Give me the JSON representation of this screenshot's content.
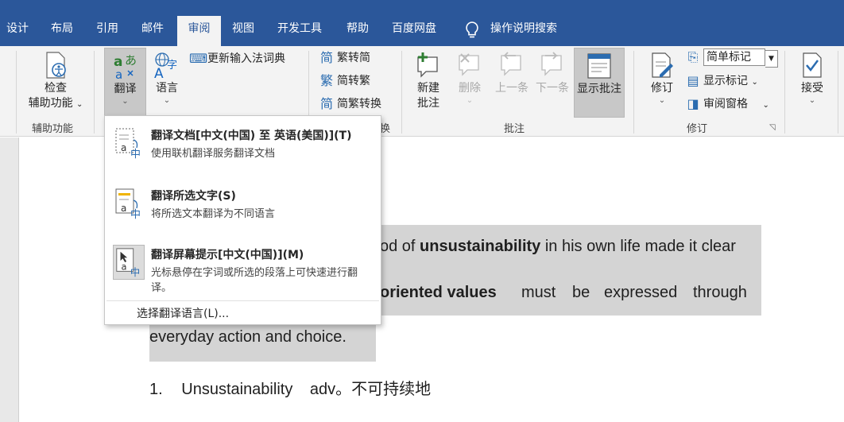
{
  "tabs": [
    "设计",
    "布局",
    "引用",
    "邮件",
    "审阅",
    "视图",
    "开发工具",
    "帮助",
    "百度网盘"
  ],
  "active_tab": "审阅",
  "tell_me": "操作说明搜索",
  "ribbon": {
    "check_accessibility": {
      "line1": "检查",
      "line2": "辅助功能"
    },
    "accessibility_group": "辅助功能",
    "translate": "翻译",
    "language": "语言",
    "update_ime": "更新输入法词典",
    "trad_to_simp": "繁转简",
    "simp_to_trad": "简转繁",
    "simp_trad_convert": "简繁转换",
    "convert_group_tail": "换",
    "new_comment": {
      "line1": "新建",
      "line2": "批注"
    },
    "delete": "删除",
    "previous": "上一条",
    "next": "下一条",
    "show_comments": "显示批注",
    "comments_group": "批注",
    "track_changes": "修订",
    "markup_mode": "简单标记",
    "show_markup": "显示标记",
    "reviewing_pane": "审阅窗格",
    "tracking_group": "修订",
    "accept": "接受"
  },
  "translate_menu": {
    "items": [
      {
        "title": "翻译文档[中文(中国) 至 英语(美国)](T)",
        "desc": "使用联机翻译服务翻译文档"
      },
      {
        "title": "翻译所选文字(S)",
        "desc": "将所选文本翻译为不同语言"
      },
      {
        "title": "翻译屏幕提示[中文(中国)](M)",
        "desc": "光标悬停在字词或所选的段落上可快速进行翻译。"
      }
    ],
    "footer": "选择翻译语言(L)..."
  },
  "document": {
    "line1_pre": "od of ",
    "line1_bold": "unsustainability",
    "line1_post": " in his own life made it clear",
    "line2_bold": "oriented values",
    "line2_w1": "must",
    "line2_w2": "be",
    "line2_w3": "expressed",
    "line2_w4": "through",
    "line3": "everyday action and choice.",
    "list_num": "1.",
    "list_word": "Unsustainability",
    "list_def": "adv。不可持续地"
  },
  "colors": {
    "tab_bar": "#2b579a",
    "ribbon": "#f3f3f3",
    "highlight": "#d4d4d4"
  }
}
